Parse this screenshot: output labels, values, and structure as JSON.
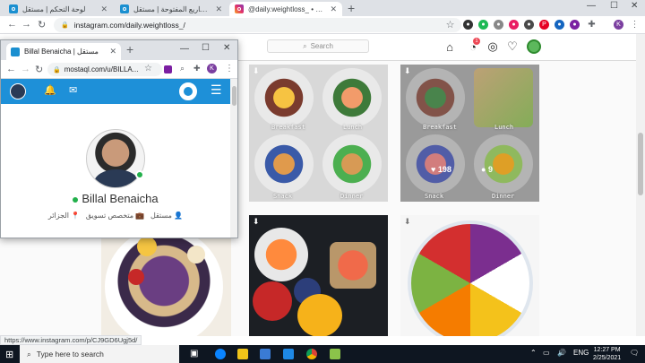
{
  "main_tabs": [
    {
      "title": "لوحة التحكم | مستقل",
      "favicon": "mostaql-icon"
    },
    {
      "title": "المشاريع المفتوحة | مستقل",
      "favicon": "mostaql-icon"
    },
    {
      "title": "@daily.weightloss_ • Instagram ...",
      "favicon": "instagram-icon"
    }
  ],
  "address_bar": {
    "url": "instagram.com/daily.weightloss_/"
  },
  "instagram": {
    "search_placeholder": "Search",
    "notification_count": "1",
    "posts": [
      {
        "kind": "meal-grid",
        "labels": [
          "Breakfast",
          "Lunch",
          "Snack",
          "Dinner"
        ]
      },
      {
        "kind": "meal-grid",
        "labels": [
          "Breakfast",
          "Lunch",
          "Snack",
          "Dinner"
        ],
        "likes": "198",
        "comments": "9"
      },
      {
        "kind": "smoothie-bowl"
      },
      {
        "kind": "breakfast-plate"
      },
      {
        "kind": "rainbow-salad"
      }
    ]
  },
  "status_url": "https://www.instagram.com/p/CJ9GD6Ugj5d/",
  "popup": {
    "tab_title": "Billal Benaicha | مستقل",
    "url": "mostaql.com/u/BILLA...",
    "profile": {
      "name": "Billal Benaicha",
      "meta": [
        {
          "icon": "user-icon",
          "text": "مستقل"
        },
        {
          "icon": "briefcase-icon",
          "text": "متخصص تسويق"
        },
        {
          "icon": "location-icon",
          "text": "الجزائر"
        }
      ]
    }
  },
  "taskbar": {
    "search_placeholder": "Type here to search",
    "lang": "ENG",
    "time": "12:27 PM",
    "date": "2/25/2021"
  },
  "colors": {
    "mostaql_blue": "#1e90d8",
    "online_green": "#22b04b",
    "ig_red": "#ed4956"
  }
}
